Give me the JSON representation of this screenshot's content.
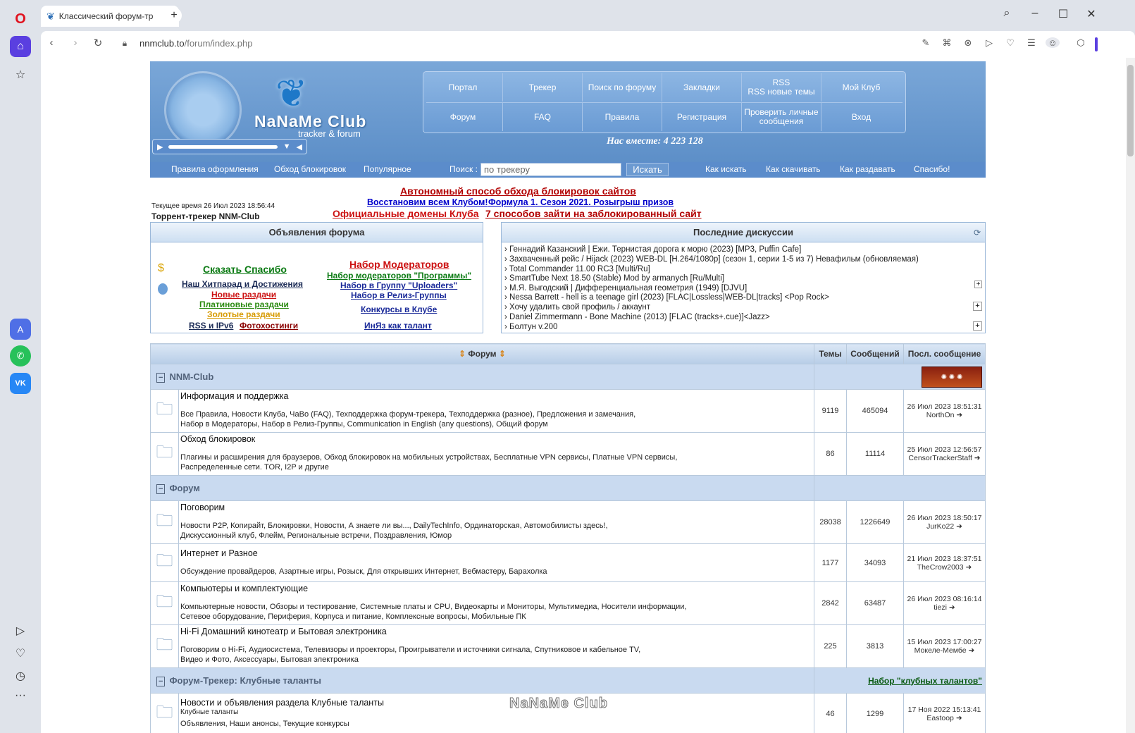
{
  "browser": {
    "tab_title": "Классический форум-тр",
    "url_host": "nnmclub.to",
    "url_path": "/forum/index.php"
  },
  "icons": {
    "opera": "opera-logo-icon",
    "home": "home-icon",
    "star": "star-icon",
    "aria": "aria-icon",
    "whatsapp": "whatsapp-icon",
    "vk": "vk-icon",
    "player": "player-icon",
    "heart": "heart-icon",
    "history": "history-icon",
    "more": "more-icon"
  },
  "header": {
    "logo": "NaNaMe Club",
    "logo_sub": "tracker & forum",
    "together": "Нас вместе: 4 223 128",
    "nav_top": [
      "Портал",
      "Трекер",
      "Поиск по форуму",
      "Закладки",
      "RSS\nRSS новые темы",
      "Мой Клуб"
    ],
    "nav_bottom": [
      "Форум",
      "FAQ",
      "Правила",
      "Регистрация",
      "Проверить личные сообщения",
      "Вход"
    ],
    "subnav_left": [
      "Правила оформления",
      "Обход блокировок",
      "Популярное"
    ],
    "search_label": "Поиск :",
    "search_placeholder": "по трекеру",
    "search_button": "Искать",
    "subnav_right": [
      "Как искать",
      "Как скачивать",
      "Как раздавать",
      "Спасибо!"
    ]
  },
  "announce": {
    "line1": "Автономный способ обхода блокировок сайтов",
    "line2a": "Восстановим всем Клубом!",
    "line2b": "Формула 1. Сезон 2021. Розыгрыш призов",
    "line3a": "Официальные домены Клуба",
    "line3b": "7 способов зайти на заблокированный сайт",
    "current_time": "Текущее время 26 Июл 2023 18:56:44",
    "site_name": "Торрент-трекер NNM-Club"
  },
  "forum_ads": {
    "title": "Объявления форума",
    "left": [
      {
        "text": "Сказать Спасибо",
        "color": "#0a7a12"
      },
      {
        "text": "Наш Хитпарад и Достижения",
        "color": "#1a2a55"
      },
      {
        "text": "Новые раздачи",
        "color": "#cc1111"
      },
      {
        "text": "Платиновые раздачи",
        "color": "#2a8a10"
      },
      {
        "text": "Золотые раздачи",
        "color": "#d79a00"
      }
    ],
    "left_last_a": "RSS и IPv6",
    "left_last_b": "Фотохостинги",
    "right": [
      {
        "text": "Набор Модераторов",
        "color": "#cc1111"
      },
      {
        "text": "Набор модераторов \"Программы\"",
        "color": "#0a7a12"
      },
      {
        "text": "Набор в Группу \"Uploaders\"",
        "color": "#1a2a99"
      },
      {
        "text": "Набор в Релиз-Группы",
        "color": "#1a2a99"
      },
      {
        "text": "Конкурсы в Клубе",
        "color": "#1a2a99"
      },
      {
        "text": "ИнЯз как талант",
        "color": "#1a2a99"
      }
    ]
  },
  "discussions": {
    "title": "Последние дискуссии",
    "items": [
      "› Геннадий Казанский | Ежи. Тернистая дорога к морю (2023) [MP3, Puffin Cafe]",
      "› Захваченный рейс / Hijack (2023) WEB-DL [H.264/1080p] (сезон 1, серии 1-5 из 7) Невафильм (обновляемая)",
      "› Total Commander 11.00 RC3 [Multi/Ru]",
      "› SmartTube Next 18.50 (Stable) Mod by armanych [Ru/Multi]",
      "› М.Я. Выгодский | Дифференциальная геометрия (1949) [DJVU]",
      "› Nessa Barrett - hell is a teenage girl (2023) [FLAC|Lossless|WEB-DL|tracks] <Pop Rock>",
      "› Хочу удалить свой профиль / аккаунт",
      "› Daniel Zimmermann - Bone Machine (2013) [FLAC (tracks+.cue)]<Jazz>",
      "› Болтун v.200"
    ]
  },
  "table": {
    "headers": [
      "Форум",
      "Темы",
      "Сообщений",
      "Посл. сообщение"
    ],
    "sections": [
      {
        "title": "NNM-Club",
        "right": "",
        "forums": [
          {
            "name": "Информация и поддержка",
            "desc": "",
            "subs": "Все Правила, Новости Клуба, ЧаВо (FAQ), Техподдержка форум-трекера, Техподдержка (разное), Предложения и замечания,\nНабор в Модераторы, Набор в Релиз-Группы, Communication in English (any questions), Общий форум",
            "topics": "9119",
            "posts": "465094",
            "last_date": "26 Июл 2023 18:51:31",
            "last_user": "NorthOn"
          },
          {
            "name": "Обход блокировок",
            "desc": "",
            "subs": "Плагины и расширения для браузеров, Обход блокировок на мобильных устройствах, Бесплатные VPN сервисы, Платные VPN сервисы,\nРаспределенные сети. TOR, I2P и другие",
            "topics": "86",
            "posts": "11114",
            "last_date": "25 Июл 2023 12:56:57",
            "last_user": "CensorTrackerStaff"
          }
        ]
      },
      {
        "title": "Форум",
        "right": "",
        "forums": [
          {
            "name": "Поговорим",
            "desc": "",
            "subs": "Новости P2P, Копирайт, Блокировки, Новости, А знаете ли вы..., DailyTechInfo, Ординаторская, Автомобилисты здесь!,\nДискуссионный клуб, Флейм, Региональные встречи, Поздравления, Юмор",
            "topics": "28038",
            "posts": "1226649",
            "last_date": "26 Июл 2023 18:50:17",
            "last_user": "JurKo22"
          },
          {
            "name": "Интернет и Разное",
            "desc": "",
            "subs": "Обсуждение провайдеров, Азартные игры, Розыск, Для открывших Интернет, Вебмастеру, Барахолка",
            "topics": "1177",
            "posts": "34093",
            "last_date": "21 Июл 2023 18:37:51",
            "last_user": "TheCrow2003"
          },
          {
            "name": "Компьютеры и комплектующие",
            "desc": "",
            "subs": "Компьютерные новости, Обзоры и тестирование, Системные платы и CPU, Видеокарты и Мониторы, Мультимедиа, Носители информации,\nСетевое оборудование, Периферия, Корпуса и питание, Комплексные вопросы, Мобильные ПК",
            "topics": "2842",
            "posts": "63487",
            "last_date": "26 Июл 2023 08:16:14",
            "last_user": "tiezi"
          },
          {
            "name": "Hi-Fi Домашний кинотеатр и Бытовая электроника",
            "desc": "",
            "subs": "Поговорим о Hi-Fi, Аудиосистема, Телевизоры и проекторы, Проигрыватели и источники сигнала, Спутниковое и кабельное TV,\nВидео и Фото, Аксессуары, Бытовая электроника",
            "topics": "225",
            "posts": "3813",
            "last_date": "15 Июл 2023 17:00:27",
            "last_user": "Мокеле-Мембе"
          }
        ]
      },
      {
        "title": "Форум-Трекер: Клубные таланты",
        "right": "Набор \"клубных талантов\"",
        "forums": [
          {
            "name": "Новости и объявления раздела Клубные таланты",
            "desc": "Клубные таланты",
            "subs": "Объявления, Наши анонсы, Текущие конкурсы",
            "topics": "46",
            "posts": "1299",
            "last_date": "17 Ноя 2022 15:13:41",
            "last_user": "Eastoop"
          }
        ]
      }
    ]
  },
  "watermark": "NaNaMe Club"
}
